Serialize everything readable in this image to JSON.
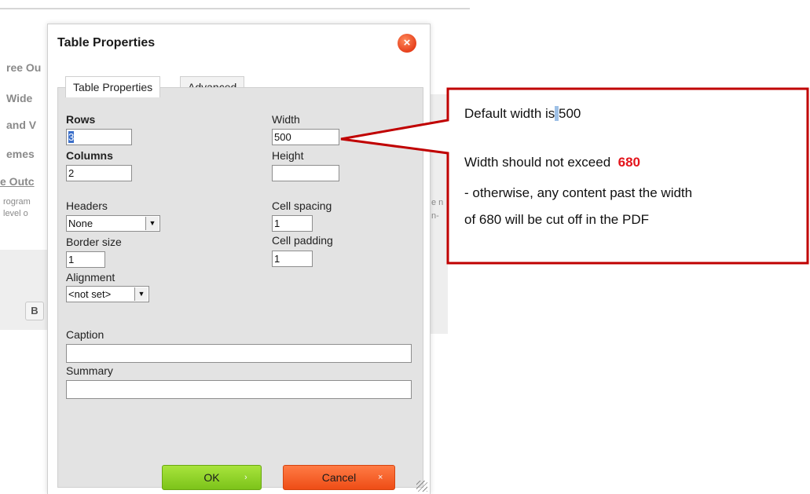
{
  "background": {
    "fragments": [
      "ree Ou",
      "Wide",
      "and V",
      "emes",
      "e Outc"
    ],
    "small_left": [
      "rogram",
      "level o"
    ],
    "small_right": [
      "e n",
      "n-"
    ],
    "bold_button": "B"
  },
  "dialog": {
    "title": "Table Properties",
    "close_glyph": "×",
    "tabs": [
      {
        "label": "Table Properties",
        "active": true
      },
      {
        "label": "Advanced",
        "active": false
      }
    ],
    "fields": {
      "rows": {
        "label": "Rows",
        "value": "3"
      },
      "columns": {
        "label": "Columns",
        "value": "2"
      },
      "headers": {
        "label": "Headers",
        "value": "None"
      },
      "border_size": {
        "label": "Border size",
        "value": "1"
      },
      "alignment": {
        "label": "Alignment",
        "value": "<not set>"
      },
      "width": {
        "label": "Width",
        "value": "500"
      },
      "height": {
        "label": "Height",
        "value": ""
      },
      "cell_spacing": {
        "label": "Cell spacing",
        "value": "1"
      },
      "cell_padding": {
        "label": "Cell padding",
        "value": "1"
      },
      "caption": {
        "label": "Caption",
        "value": ""
      },
      "summary": {
        "label": "Summary",
        "value": ""
      }
    },
    "buttons": {
      "ok": "OK",
      "ok_glyph": "›",
      "cancel": "Cancel",
      "cancel_glyph": "×"
    }
  },
  "callout": {
    "line1_prefix": "Default width is",
    "line1_value": "500",
    "line2_prefix": "Width should not exceed",
    "line2_value": "680",
    "line3": "- otherwise, any content past the width",
    "line4": "of 680 will be cut off in the PDF",
    "border_color": "#c00000",
    "highlight_color": "#e3141b"
  },
  "icons": [
    "close-icon",
    "chevron-down-icon",
    "chevron-right-icon",
    "resize-grip-icon"
  ]
}
